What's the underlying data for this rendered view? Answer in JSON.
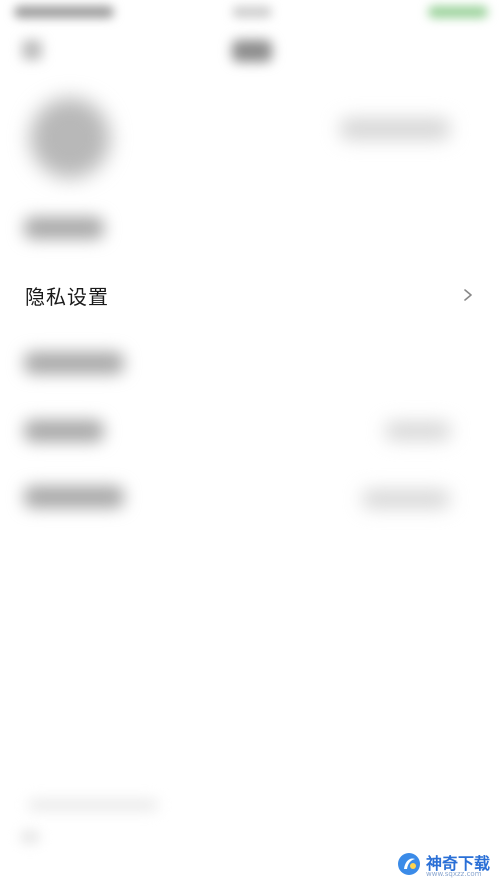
{
  "settings": {
    "privacy_label": "隐私设置"
  },
  "watermark": {
    "brand": "神奇下载",
    "url": "www.sqxzz.com"
  }
}
